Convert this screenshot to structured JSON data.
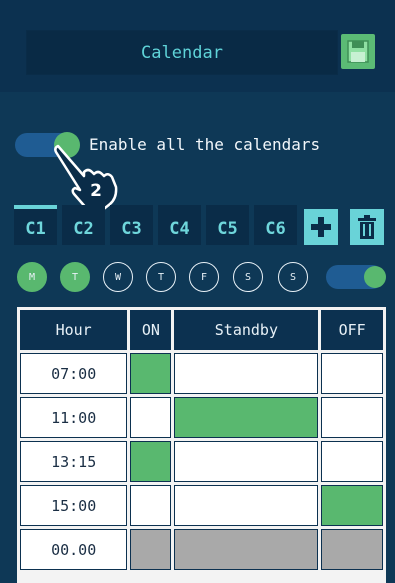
{
  "header": {
    "title": "Calendar",
    "save_icon": "floppy-disk-icon"
  },
  "enable_all": {
    "label": "Enable all the calendars",
    "enabled": true
  },
  "tutorial_hint": {
    "step": "2",
    "icon": "tap-hand-icon"
  },
  "tabs": [
    {
      "label": "C1",
      "active": true
    },
    {
      "label": "C2",
      "active": false
    },
    {
      "label": "C3",
      "active": false
    },
    {
      "label": "C4",
      "active": false
    },
    {
      "label": "C5",
      "active": false
    },
    {
      "label": "C6",
      "active": false
    }
  ],
  "tab_actions": {
    "add_icon": "plus-icon",
    "delete_icon": "trash-icon"
  },
  "days": [
    {
      "label": "M",
      "selected": true
    },
    {
      "label": "T",
      "selected": true
    },
    {
      "label": "W",
      "selected": false
    },
    {
      "label": "T",
      "selected": false
    },
    {
      "label": "F",
      "selected": false
    },
    {
      "label": "S",
      "selected": false
    },
    {
      "label": "S",
      "selected": false
    }
  ],
  "day_toggle": {
    "enabled": true
  },
  "schedule": {
    "columns": [
      "Hour",
      "ON",
      "Standby",
      "OFF"
    ],
    "rows": [
      {
        "hour": "07:00",
        "state": "ON"
      },
      {
        "hour": "11:00",
        "state": "Standby"
      },
      {
        "hour": "13:15",
        "state": "ON"
      },
      {
        "hour": "15:00",
        "state": "OFF"
      },
      {
        "hour": "00.00",
        "state": "disabled"
      }
    ]
  },
  "colors": {
    "background": "#0e3856",
    "accent_green": "#59b86f",
    "accent_cyan": "#69d3d8",
    "disabled_gray": "#a9a9a9"
  }
}
